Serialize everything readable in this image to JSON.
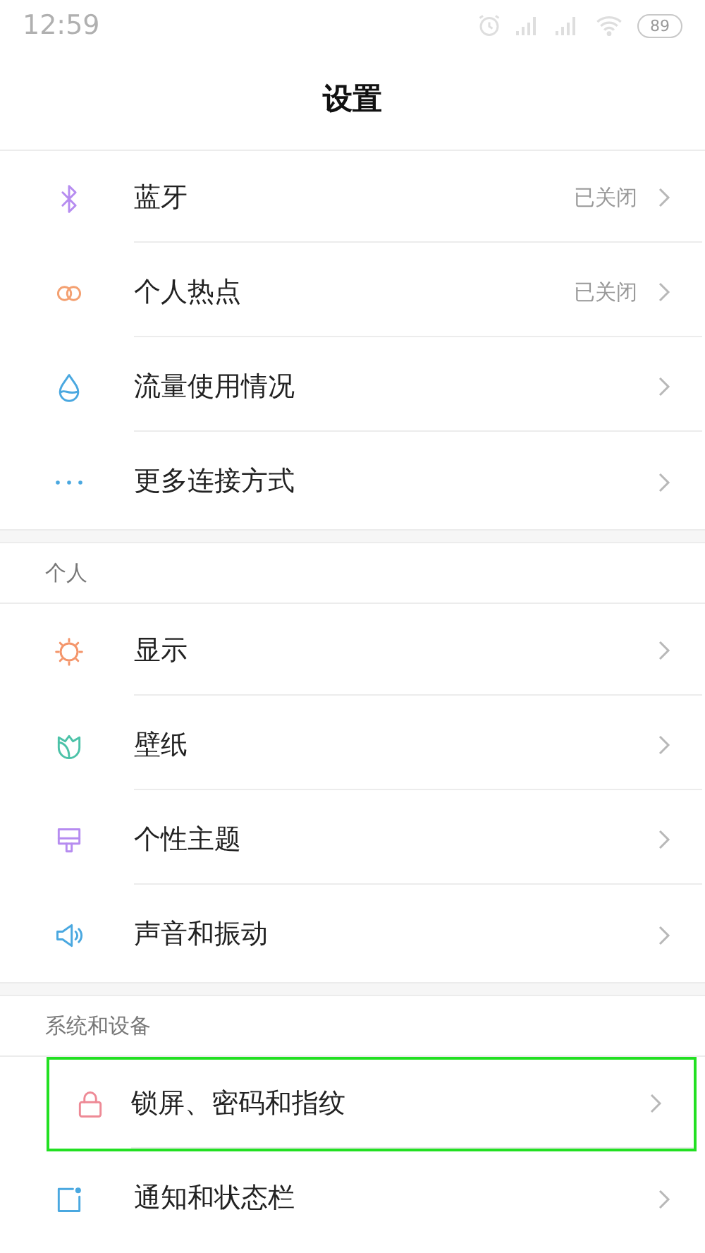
{
  "status_bar": {
    "time": "12:59",
    "battery": "89"
  },
  "title": "设置",
  "sections": [
    {
      "items": [
        {
          "label": "蓝牙",
          "value": "已关闭",
          "highlighted": false
        },
        {
          "label": "个人热点",
          "value": "已关闭",
          "highlighted": false
        },
        {
          "label": "流量使用情况",
          "highlighted": false
        },
        {
          "label": "更多连接方式",
          "highlighted": false
        }
      ]
    },
    {
      "header": "个人",
      "items": [
        {
          "label": "显示",
          "highlighted": false
        },
        {
          "label": "壁纸",
          "highlighted": false
        },
        {
          "label": "个性主题",
          "highlighted": false
        },
        {
          "label": "声音和振动",
          "highlighted": false
        }
      ]
    },
    {
      "header": "系统和设备",
      "items": [
        {
          "label": "锁屏、密码和指纹",
          "highlighted": true
        },
        {
          "label": "通知和状态栏",
          "highlighted": false
        }
      ]
    }
  ]
}
